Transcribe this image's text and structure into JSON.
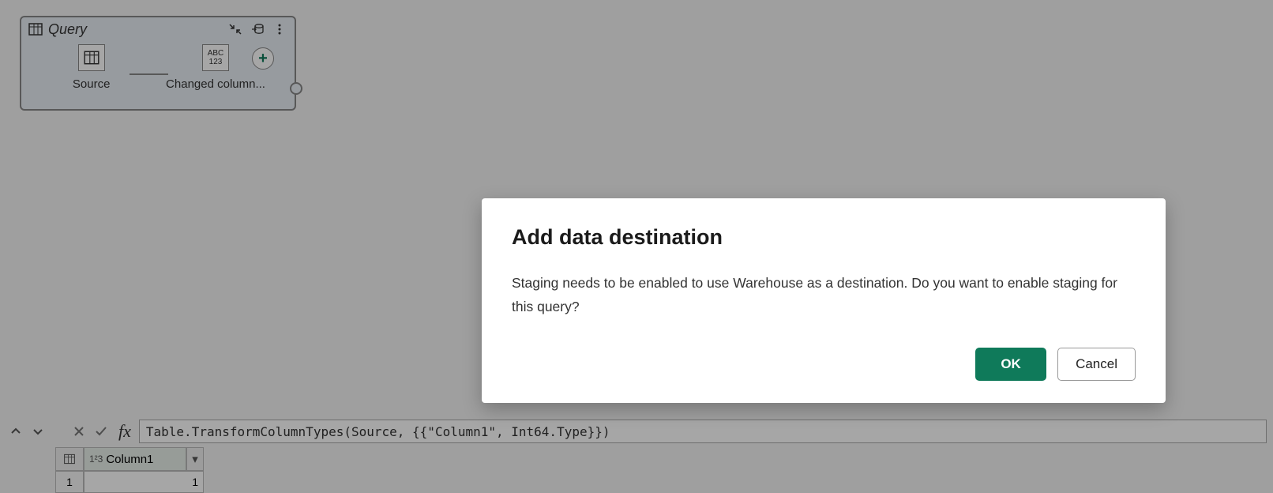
{
  "query_node": {
    "title": "Query",
    "steps": [
      {
        "label": "Source",
        "icon": "table"
      },
      {
        "label": "Changed column...",
        "icon": "abc123"
      }
    ]
  },
  "formula_bar": {
    "fx_label": "fx",
    "formula": "Table.TransformColumnTypes(Source, {{\"Column1\", Int64.Type}})"
  },
  "grid": {
    "column_type_label": "1²3",
    "column_name": "Column1",
    "rows": [
      {
        "index": "1",
        "value": "1"
      }
    ]
  },
  "dialog": {
    "title": "Add data destination",
    "message": "Staging needs to be enabled to use Warehouse as a destination. Do you want to enable staging for this query?",
    "ok_label": "OK",
    "cancel_label": "Cancel"
  }
}
